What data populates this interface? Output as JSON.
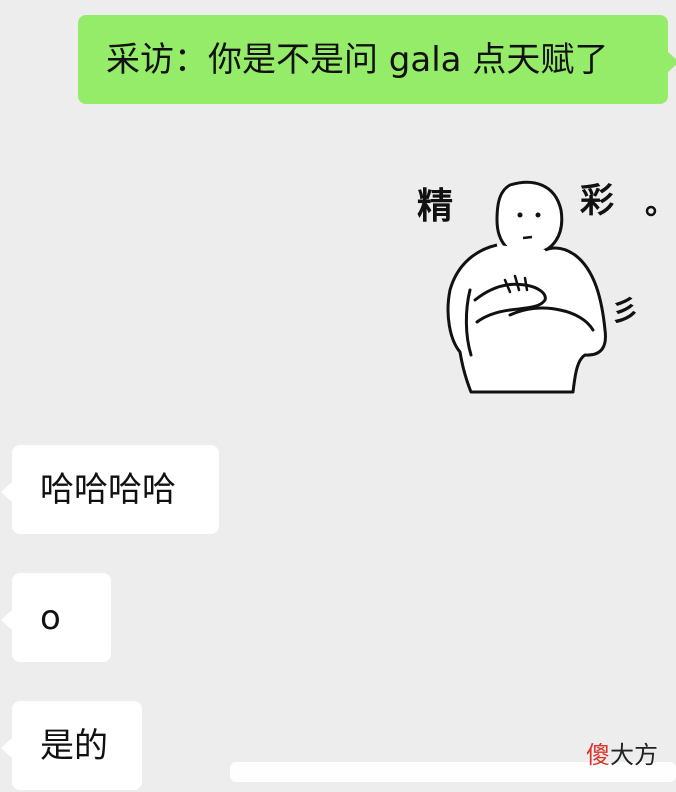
{
  "messages": [
    {
      "side": "out",
      "text": "采访：你是不是问 gala 点天赋了"
    },
    {
      "side": "in",
      "text": "哈哈哈哈"
    },
    {
      "side": "in",
      "text": "o"
    },
    {
      "side": "in",
      "text": "是的"
    }
  ],
  "sticker": {
    "left_char": "精",
    "right_char": "彩",
    "punct": "。",
    "side_marks": "彡"
  },
  "watermark": {
    "red_part": "傻",
    "dark_part": "大方"
  },
  "colors": {
    "background": "#ededed",
    "outgoing_bubble": "#95ec69",
    "incoming_bubble": "#ffffff",
    "watermark_red": "#d8362b"
  }
}
